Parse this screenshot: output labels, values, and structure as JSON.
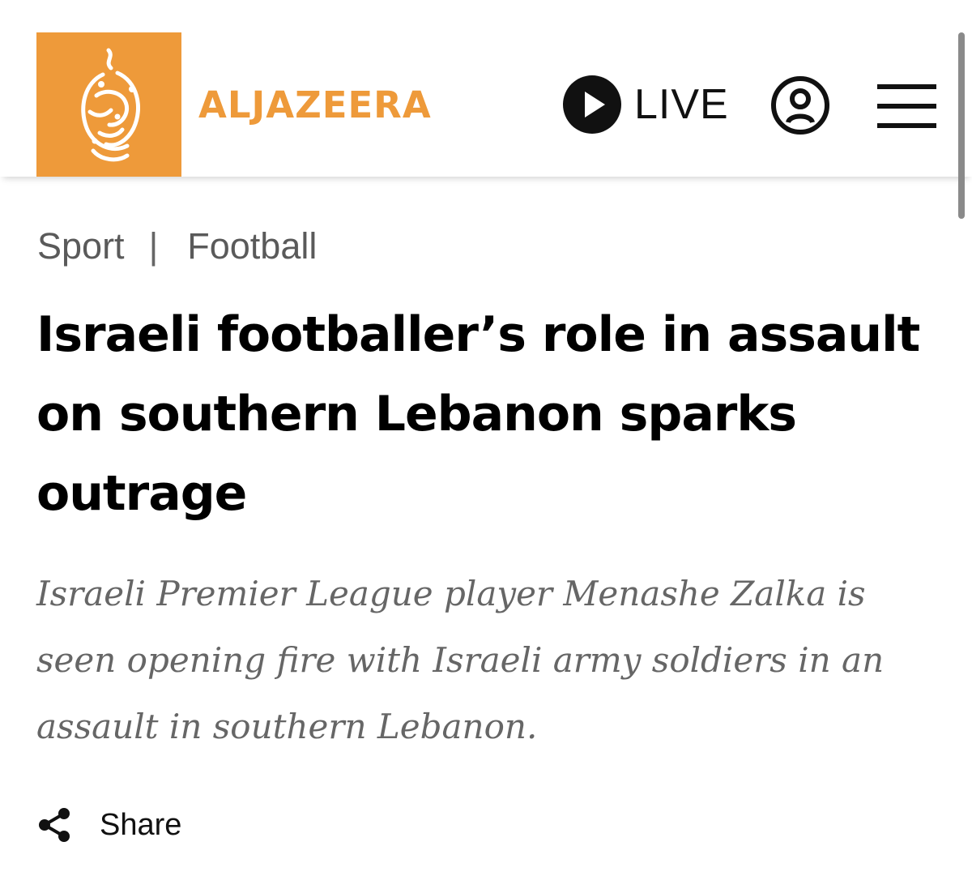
{
  "header": {
    "logo_arabic_text": "الجزيرة",
    "brand_name": "ALJAZEERA",
    "live_label": "LIVE",
    "accent_color": "#ee9a3a",
    "icons": {
      "live": "play-circle-icon",
      "account": "user-circle-icon",
      "menu": "hamburger-menu-icon"
    }
  },
  "breadcrumb": {
    "section": "Sport",
    "separator": "|",
    "subsection": "Football"
  },
  "article": {
    "headline": "Israeli footballer’s role in assault on southern Lebanon sparks outrage",
    "subhead": "Israeli Premier League player Menashe Zalka is seen opening fire with Israeli army soldiers in an assault in southern Lebanon."
  },
  "share": {
    "label": "Share",
    "icon": "share-icon"
  }
}
